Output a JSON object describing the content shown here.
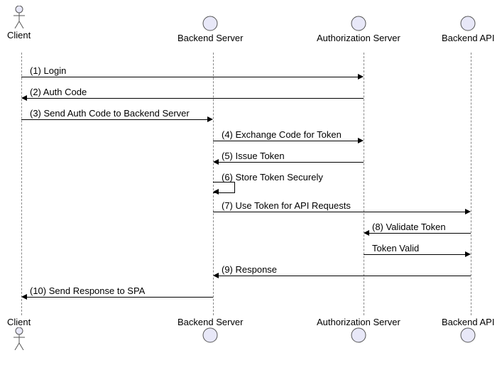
{
  "participants": {
    "client": "Client",
    "backend_server": "Backend Server",
    "authorization_server": "Authorization Server",
    "backend_api": "Backend API"
  },
  "messages": {
    "m1": "(1) Login",
    "m2": "(2) Auth Code",
    "m3": "(3) Send Auth Code to Backend Server",
    "m4": "(4) Exchange Code for Token",
    "m5": "(5) Issue Token",
    "m6": "(6) Store Token Securely",
    "m7": "(7) Use Token for API Requests",
    "m8": "(8) Validate Token",
    "m9": "Token Valid",
    "m10": "(9) Response",
    "m11": "(10) Send Response to SPA"
  },
  "chart_data": {
    "type": "sequence-diagram",
    "participants": [
      {
        "id": "client",
        "name": "Client",
        "kind": "actor"
      },
      {
        "id": "backend_server",
        "name": "Backend Server",
        "kind": "boundary"
      },
      {
        "id": "authorization_server",
        "name": "Authorization Server",
        "kind": "boundary"
      },
      {
        "id": "backend_api",
        "name": "Backend API",
        "kind": "boundary"
      }
    ],
    "messages": [
      {
        "from": "client",
        "to": "authorization_server",
        "label": "(1) Login"
      },
      {
        "from": "authorization_server",
        "to": "client",
        "label": "(2) Auth Code"
      },
      {
        "from": "client",
        "to": "backend_server",
        "label": "(3) Send Auth Code to Backend Server"
      },
      {
        "from": "backend_server",
        "to": "authorization_server",
        "label": "(4) Exchange Code for Token"
      },
      {
        "from": "authorization_server",
        "to": "backend_server",
        "label": "(5) Issue Token"
      },
      {
        "from": "backend_server",
        "to": "backend_server",
        "label": "(6) Store Token Securely"
      },
      {
        "from": "backend_server",
        "to": "backend_api",
        "label": "(7) Use Token for API Requests"
      },
      {
        "from": "backend_api",
        "to": "authorization_server",
        "label": "(8) Validate Token"
      },
      {
        "from": "authorization_server",
        "to": "backend_api",
        "label": "Token Valid"
      },
      {
        "from": "backend_api",
        "to": "backend_server",
        "label": "(9) Response"
      },
      {
        "from": "backend_server",
        "to": "client",
        "label": "(10) Send Response to SPA"
      }
    ]
  }
}
